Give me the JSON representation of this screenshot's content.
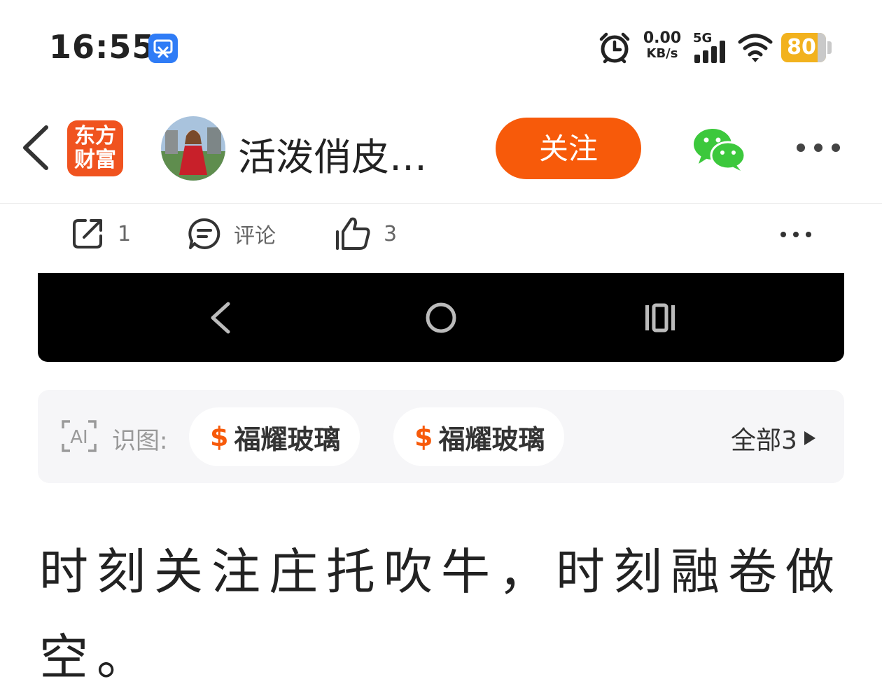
{
  "status_bar": {
    "time": "16:55",
    "net_speed_value": "0.00",
    "net_speed_unit": "KB/s",
    "network": "5G",
    "battery": "80",
    "icons": [
      "screen-recorder-icon",
      "alarm-icon",
      "signal-icon",
      "wifi-icon",
      "battery-icon"
    ],
    "battery_color": "#f2b21e"
  },
  "header": {
    "logo_line1": "东方",
    "logo_line2": "财富",
    "username": "活泼俏皮…",
    "follow_label": "关注",
    "accent_color": "#f75a0a",
    "icons": [
      "back-icon",
      "wechat-icon",
      "more-icon"
    ]
  },
  "actions": {
    "share_count": "1",
    "comment_label": "评论",
    "like_count": "3",
    "icons": [
      "share-icon",
      "comment-icon",
      "like-icon",
      "more-icon"
    ]
  },
  "embedded_image": {
    "description_icons": [
      "nav-back-icon",
      "nav-home-icon",
      "nav-recents-icon"
    ]
  },
  "ai_tags": {
    "icon_text": "AI",
    "label": "识图:",
    "tags": [
      {
        "symbol": "$",
        "name": "福耀玻璃"
      },
      {
        "symbol": "$",
        "name": "福耀玻璃"
      }
    ],
    "all_label": "全部3"
  },
  "post": {
    "text": "时刻关注庄托吹牛，时刻融卷做空。"
  }
}
